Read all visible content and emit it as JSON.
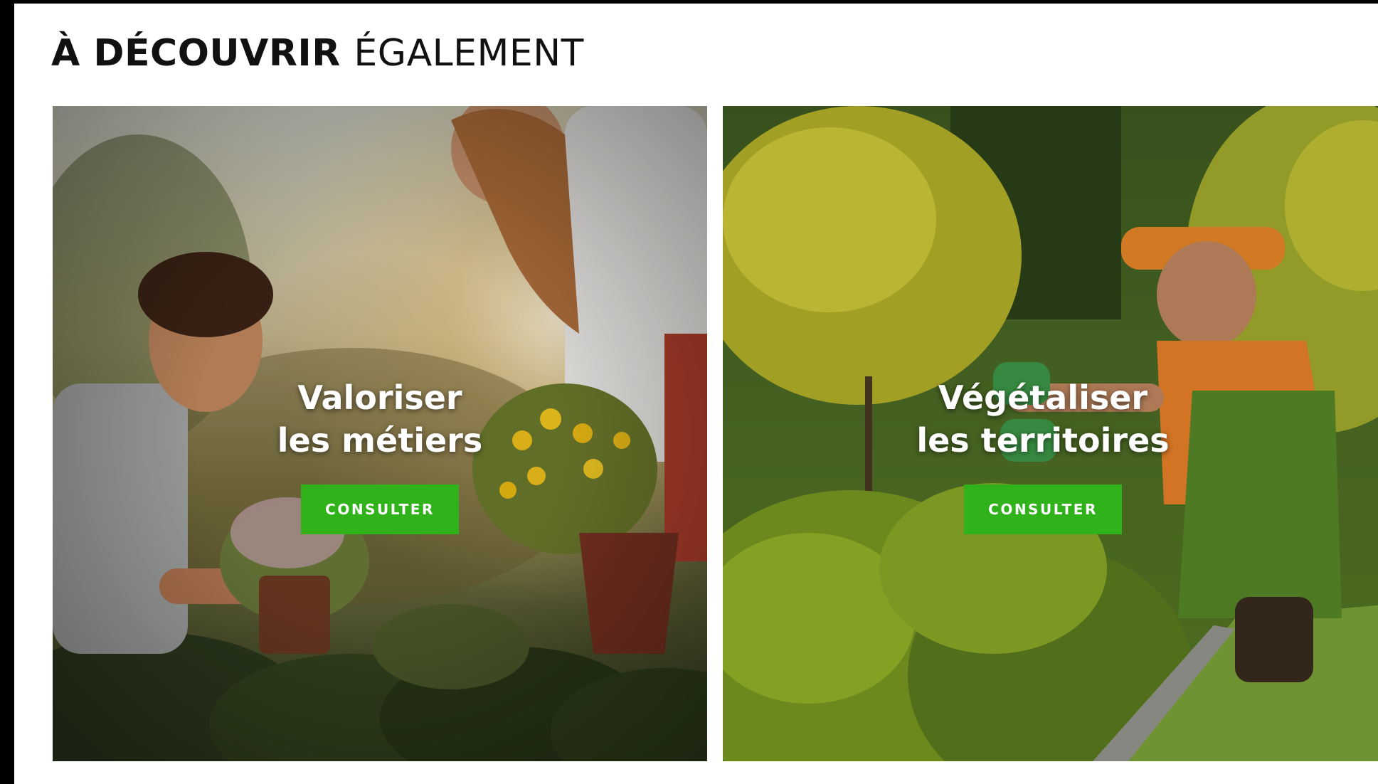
{
  "section": {
    "title_strong": "À DÉCOUVRIR",
    "title_light": "ÉGALEMENT"
  },
  "cards": [
    {
      "title_line1": "Valoriser",
      "title_line2": "les métiers",
      "button_label": "CONSULTER",
      "image": "gardeners-planting-flowers-photo"
    },
    {
      "title_line1": "Végétaliser",
      "title_line2": "les territoires",
      "button_label": "CONSULTER",
      "image": "gardener-trimming-hedge-photo"
    }
  ],
  "colors": {
    "button": "#2fb21a",
    "title_text": "#111111",
    "overlay_text": "#ffffff"
  }
}
